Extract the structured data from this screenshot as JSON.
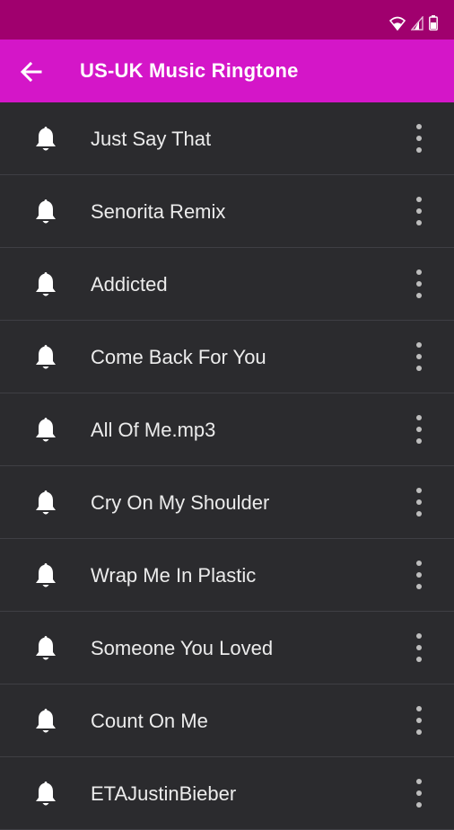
{
  "status_bar": {
    "icons": [
      "wifi-icon",
      "signal-icon",
      "battery-icon"
    ]
  },
  "app_bar": {
    "title": "US-UK Music Ringtone",
    "back_icon": "arrow-left-icon"
  },
  "list": {
    "items": [
      {
        "title": "Just Say That"
      },
      {
        "title": "Senorita Remix"
      },
      {
        "title": "Addicted"
      },
      {
        "title": "Come Back For You"
      },
      {
        "title": "All Of Me.mp3"
      },
      {
        "title": "Cry On My Shoulder"
      },
      {
        "title": "Wrap Me In Plastic"
      },
      {
        "title": "Someone You Loved"
      },
      {
        "title": "Count On Me"
      },
      {
        "title": "ETAJustinBieber"
      }
    ],
    "item_icon": "bell-icon",
    "menu_icon": "more-vertical-icon"
  },
  "colors": {
    "status_bar": "#a0006e",
    "app_bar": "#d416c8",
    "background": "#2b2b2e",
    "divider": "#3f3f44",
    "text": "#ececec"
  }
}
